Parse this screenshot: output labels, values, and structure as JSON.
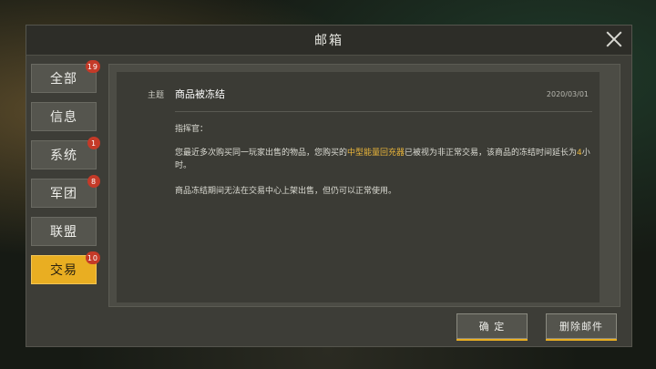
{
  "window": {
    "title": "邮箱"
  },
  "sidebar": {
    "tabs": [
      {
        "label": "全部",
        "badge": "19",
        "active": false
      },
      {
        "label": "信息",
        "badge": "",
        "active": false
      },
      {
        "label": "系统",
        "badge": "1",
        "active": false
      },
      {
        "label": "军团",
        "badge": "8",
        "active": false
      },
      {
        "label": "联盟",
        "badge": "",
        "active": false
      },
      {
        "label": "交易",
        "badge": "10",
        "active": true
      }
    ]
  },
  "mail": {
    "subject_label": "主题",
    "subject": "商品被冻结",
    "date": "2020/03/01",
    "greeting": "指挥官：",
    "body1_part1": "您最近多次购买同一玩家出售的物品，您购买的",
    "body1_item": "中型能量回充器",
    "body1_part2": "已被视为非正常交易，该商品的冻结时间延长为",
    "body1_hours": "4",
    "body1_part3": "小时。",
    "body2": "商品冻结期间无法在交易中心上架出售，但仍可以正常使用。"
  },
  "buttons": {
    "confirm": "确 定",
    "delete": "删除邮件"
  },
  "colors": {
    "accent": "#e9ae22",
    "badge": "#c43a28",
    "highlight": "#e8b43a"
  }
}
